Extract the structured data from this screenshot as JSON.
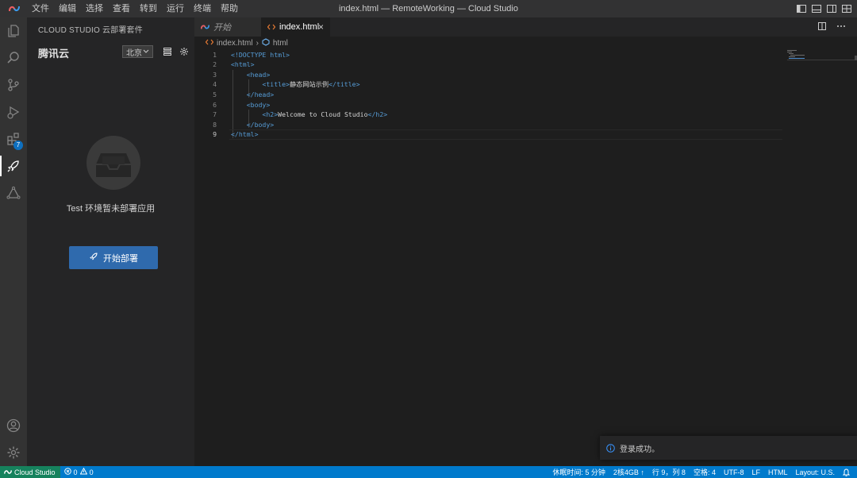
{
  "menubar": {
    "items": [
      "文件",
      "编辑",
      "选择",
      "查看",
      "转到",
      "运行",
      "终端",
      "帮助"
    ],
    "window_title": "index.html — RemoteWorking — Cloud Studio"
  },
  "activitybar": {
    "icons": [
      "explorer-icon",
      "search-icon",
      "source-control-icon",
      "run-debug-icon",
      "extensions-icon",
      "rocket-icon",
      "cloud-deploy-icon",
      "account-icon",
      "settings-gear-icon"
    ],
    "extensions_badge": "7"
  },
  "sidebar": {
    "title": "CLOUD STUDIO 云部署套件",
    "brand": "腾讯云",
    "region": "北京",
    "empty_message": "Test 环境暂未部署应用",
    "deploy_button": "开始部署"
  },
  "tabs": [
    {
      "label": "开始",
      "active": false
    },
    {
      "label": "index.html",
      "active": true
    }
  ],
  "breadcrumb": {
    "file": "index.html",
    "symbol": "html"
  },
  "editor": {
    "current_line": 9,
    "lines": [
      {
        "n": "1",
        "parts": [
          [
            "tag",
            "<!DOCTYPE "
          ],
          [
            "kw",
            "html"
          ],
          [
            "tag",
            ">"
          ]
        ]
      },
      {
        "n": "2",
        "parts": [
          [
            "tag",
            "<html>"
          ]
        ]
      },
      {
        "n": "3",
        "parts": [
          [
            "txt",
            "    "
          ],
          [
            "tag",
            "<head>"
          ]
        ]
      },
      {
        "n": "4",
        "parts": [
          [
            "txt",
            "        "
          ],
          [
            "tag",
            "<title>"
          ],
          [
            "txt",
            "静态网站示例"
          ],
          [
            "tag",
            "</title>"
          ]
        ]
      },
      {
        "n": "5",
        "parts": [
          [
            "txt",
            "    "
          ],
          [
            "tag",
            "</head>"
          ]
        ]
      },
      {
        "n": "6",
        "parts": [
          [
            "txt",
            "    "
          ],
          [
            "tag",
            "<body>"
          ]
        ]
      },
      {
        "n": "7",
        "parts": [
          [
            "txt",
            "        "
          ],
          [
            "tag",
            "<h2>"
          ],
          [
            "txt",
            "Welcome to Cloud Studio"
          ],
          [
            "tag",
            "</h2>"
          ]
        ]
      },
      {
        "n": "8",
        "parts": [
          [
            "txt",
            "    "
          ],
          [
            "tag",
            "</body>"
          ]
        ]
      },
      {
        "n": "9",
        "parts": [
          [
            "tag",
            "</html>"
          ]
        ]
      }
    ]
  },
  "notification": {
    "message": "登录成功。"
  },
  "statusbar": {
    "remote": "Cloud Studio",
    "errors": "0",
    "warnings": "0",
    "sleep_time": "休眠时间: 5 分钟",
    "resources": "2核4GB ↑",
    "cursor": "行 9，列 8",
    "spaces": "空格: 4",
    "encoding": "UTF-8",
    "eol": "LF",
    "language": "HTML",
    "layout": "Layout: U.S."
  },
  "colors": {
    "statusbar": "#007acc",
    "remote": "#16825d",
    "deploy_button": "#2f6aad",
    "tag": "#569cd6"
  }
}
